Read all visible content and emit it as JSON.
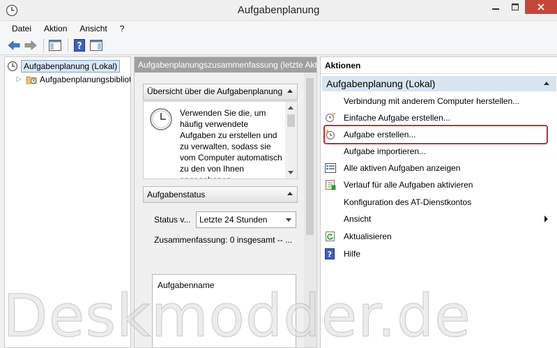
{
  "window": {
    "title": "Aufgabenplanung"
  },
  "menubar": {
    "items": [
      "Datei",
      "Aktion",
      "Ansicht",
      "?"
    ]
  },
  "toolbar": {
    "buttons": [
      "back-icon",
      "forward-icon",
      "show-hide-tree-icon",
      "help-icon",
      "action-pane-icon"
    ]
  },
  "tree": {
    "root_label": "Aufgabenplanung (Lokal)",
    "child_label": "Aufgabenplanungsbibliot"
  },
  "middle": {
    "header": "Aufgabenplanungszusammenfassung (letzte Akt",
    "overview": {
      "title": "Übersicht über die Aufgabenplanung",
      "text": "Verwenden Sie die, um häufig verwendete Aufgaben zu erstellen und zu verwalten, sodass sie vom Computer automatisch zu den von Ihnen angegebenen"
    },
    "status": {
      "title": "Aufgabenstatus",
      "label": "Status v...",
      "selected": "Letzte 24 Stunden",
      "summary": "Zusammenfassung: 0 insgesamt -- ...",
      "column_header": "Aufgabenname"
    }
  },
  "actions": {
    "header": "Aktionen",
    "group_title": "Aufgabenplanung (Lokal)",
    "items": [
      {
        "label": "Verbindung mit anderem Computer herstellen...",
        "icon": ""
      },
      {
        "label": "Einfache Aufgabe erstellen...",
        "icon": "wizard-icon"
      },
      {
        "label": "Aufgabe erstellen...",
        "icon": "create-task-icon"
      },
      {
        "label": "Aufgabe importieren...",
        "icon": ""
      },
      {
        "label": "Alle aktiven Aufgaben anzeigen",
        "icon": "list-icon"
      },
      {
        "label": "Verlauf für alle Aufgaben aktivieren",
        "icon": "history-icon"
      },
      {
        "label": "Konfiguration des AT-Dienstkontos",
        "icon": ""
      },
      {
        "label": "Ansicht",
        "icon": ""
      },
      {
        "label": "Aktualisieren",
        "icon": "refresh-icon"
      },
      {
        "label": "Hilfe",
        "icon": "help-icon"
      }
    ],
    "highlight_color": "#c62d2d"
  },
  "watermark": {
    "text": "Deskmodder.de"
  }
}
